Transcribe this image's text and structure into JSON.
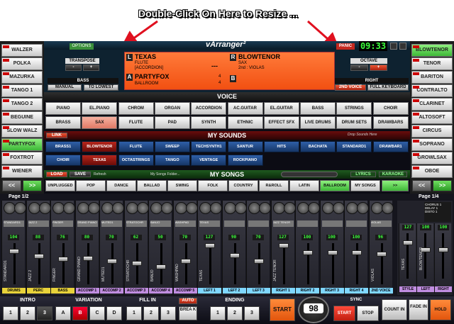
{
  "annotation": "Double-Click On Here to Resize ...",
  "left_buttons": [
    "WALZER",
    "POLKA",
    "MAZURKA",
    "TANGO 1",
    "TANGO 2",
    "BEGUINE",
    "SLOW WALZ",
    "PARTYFOX",
    "FOXTROT",
    "WIENER"
  ],
  "left_selected": "PARTYFOX",
  "right_buttons": [
    "BLOWTENOR",
    "TENOR",
    "BARITON",
    "CONTRALTO",
    "CLARINET",
    "ALTOSOFT",
    "CIRCUS",
    "SOPRANO",
    "GROWLSAX",
    "OBOE"
  ],
  "nav": {
    "prev": "<<",
    "next": ">>"
  },
  "header": {
    "options": "OPTIONS",
    "brand": "vArranger²",
    "panic": "PANIC",
    "clock": "09:33"
  },
  "transpose": {
    "label": "TRANSPOSE",
    "minus": "-",
    "plus": "+"
  },
  "bass": {
    "label": "BASS",
    "manual": "MANUAL",
    "to_lowest": "TO LOWEST"
  },
  "octave": {
    "label": "OCTAVE",
    "minus": "-",
    "plus": "+"
  },
  "right": {
    "label": "RIGHT",
    "voice2": "2ND VOICE",
    "full_keyboard": "FULL KEYBOARD"
  },
  "display": {
    "l_letter": "L",
    "l_name": "TEXAS",
    "l_sub1": "FLUTE",
    "l_sub2": "[ACCORDION]",
    "l_dashes": "---",
    "r_letter": "R",
    "r_name": "BLOWTENOR",
    "r_sub1": "SAX",
    "r_sub2": "2nd : VIOLAS",
    "a_letter": "A",
    "a_name": "PARTYFOX",
    "a_sub": "BALLROOM",
    "a_num1": "4",
    "a_num2": "4",
    "b_letter": "B"
  },
  "voice": {
    "title": "VOICE",
    "row1": [
      "PIANO",
      "EL.PIANO",
      "CHROM",
      "ORGAN",
      "ACCORDION",
      "AC.GUITAR",
      "EL.GUITAR",
      "BASS",
      "STRINGS",
      "CHOIR"
    ],
    "row2": [
      "BRASS",
      "SAX",
      "FLUTE",
      "PAD",
      "SYNTH",
      "ETHNIC",
      "EFFECT SFX",
      "LIVE DRUMS",
      "DRUM SETS",
      "DRAWBARS"
    ],
    "selected": "SAX"
  },
  "my_sounds": {
    "title": "MY SOUNDS",
    "link": "LINK",
    "hint": "Drop Sounds Here",
    "row1": [
      "BRASS1",
      "BLOWTENOR",
      "FLUTE",
      "SWEEP",
      "TECHSYNTH1",
      "SANTUR",
      "HITS",
      "BACHATA",
      "STANDARD1",
      "DRAWBAR1"
    ],
    "row2": [
      "CHOIR",
      "TEXAS",
      "OCTASTRINGS",
      "TANGO",
      "VENTAGE",
      "ROCKPIANO"
    ],
    "selected": [
      "BLOWTENOR",
      "TEXAS"
    ]
  },
  "my_songs": {
    "title": "MY SONGS",
    "load": "LOAD",
    "save": "SAVE",
    "refresh": "Refresh",
    "folder": "My Songs Folder...",
    "lyrics": "LYRICS",
    "karaoke": "KARAOKE",
    "row": [
      "UNPLUGGED",
      "POP",
      "DANCE",
      "BALLAD",
      "SWING",
      "FOLK",
      "COUNTRY",
      "R&ROLL",
      "LATIN",
      "BALLROOM",
      "MY SONGS"
    ],
    "selected": "BALLROOM",
    "next": ">>"
  },
  "mixer": {
    "page_left": "Page 1/2",
    "page_right": "Page 1/4",
    "channels": [
      {
        "name": "STANDARD1",
        "vol": "104",
        "fader": 0.85,
        "label": "DRUMS",
        "color": "#e8d23a"
      },
      {
        "name": "JAZZ 2",
        "vol": "88",
        "fader": 0.7,
        "label": "PERC",
        "color": "#e8d23a"
      },
      {
        "name": "FINGER",
        "vol": "76",
        "fader": 0.62,
        "label": "BASS",
        "color": "#e8d23a"
      },
      {
        "name": "GRAND PIANO",
        "vol": "80",
        "fader": 0.64,
        "label": "ACCOMP 1",
        "color": "#c08de0"
      },
      {
        "name": "MUTED1",
        "vol": "70",
        "fader": 0.56,
        "label": "ACCOMP 2",
        "color": "#c08de0"
      },
      {
        "name": "STRATOCHR",
        "vol": "62",
        "fader": 0.5,
        "label": "ACCOMP 3",
        "color": "#c08de0"
      },
      {
        "name": "BANJO",
        "vol": "50",
        "fader": 0.4,
        "label": "ACCOMP 4",
        "color": "#c08de0"
      },
      {
        "name": "WASHPAD",
        "vol": "70",
        "fader": 0.56,
        "label": "ACCOMP 5",
        "color": "#c08de0"
      },
      {
        "name": "TEXAS",
        "vol": "127",
        "fader": 1.0,
        "label": "LEFT 1",
        "color": "#7fd7ff"
      },
      {
        "name": "",
        "vol": "90",
        "fader": 0.72,
        "label": "LEFT 2",
        "color": "#7fd7ff"
      },
      {
        "name": "",
        "vol": "70",
        "fader": 0.56,
        "label": "LEFT 3",
        "color": "#7fd7ff"
      },
      {
        "name": "JAZZ TENOR",
        "vol": "127",
        "fader": 1.0,
        "label": "RIGHT 1",
        "color": "#7fd7ff"
      },
      {
        "name": "",
        "vol": "100",
        "fader": 0.8,
        "label": "RIGHT 2",
        "color": "#7fd7ff"
      },
      {
        "name": "",
        "vol": "100",
        "fader": 0.8,
        "label": "RIGHT 3",
        "color": "#7fd7ff"
      },
      {
        "name": "",
        "vol": "100",
        "fader": 0.8,
        "label": "RIGHT 4",
        "color": "#7fd7ff"
      },
      {
        "name": "VIOLAS",
        "vol": "96",
        "fader": 0.76,
        "label": "2ND VOICE",
        "color": "#7fd7ff"
      }
    ],
    "master": {
      "fx": [
        "CHORUS 1",
        "DELAY 1",
        "DISTO 1"
      ],
      "vals": [
        "127",
        "100",
        "100"
      ],
      "labels": [
        "STYLE",
        "LEFT",
        "RIGHT"
      ],
      "names": [
        "TEXAS",
        "BLOWTENOR"
      ]
    }
  },
  "bottom": {
    "intro": "INTRO",
    "intro_btns": [
      "1",
      "2",
      "3"
    ],
    "variation": "VARIATION",
    "variation_btns": [
      "A",
      "B",
      "C",
      "D"
    ],
    "fillin": "FILL IN",
    "auto": "AUTO",
    "fillin_btns": [
      "1",
      "2",
      "3"
    ],
    "break": "BREA K",
    "ending": "ENDING",
    "ending_btns": [
      "1",
      "2",
      "3"
    ],
    "start": "START",
    "tempo": "98",
    "sync": "SYNC",
    "sync_start": "START",
    "sync_stop": "STOP",
    "count_in": "COUNT IN",
    "fade_in": "FADE IN",
    "hold": "HOLD"
  }
}
